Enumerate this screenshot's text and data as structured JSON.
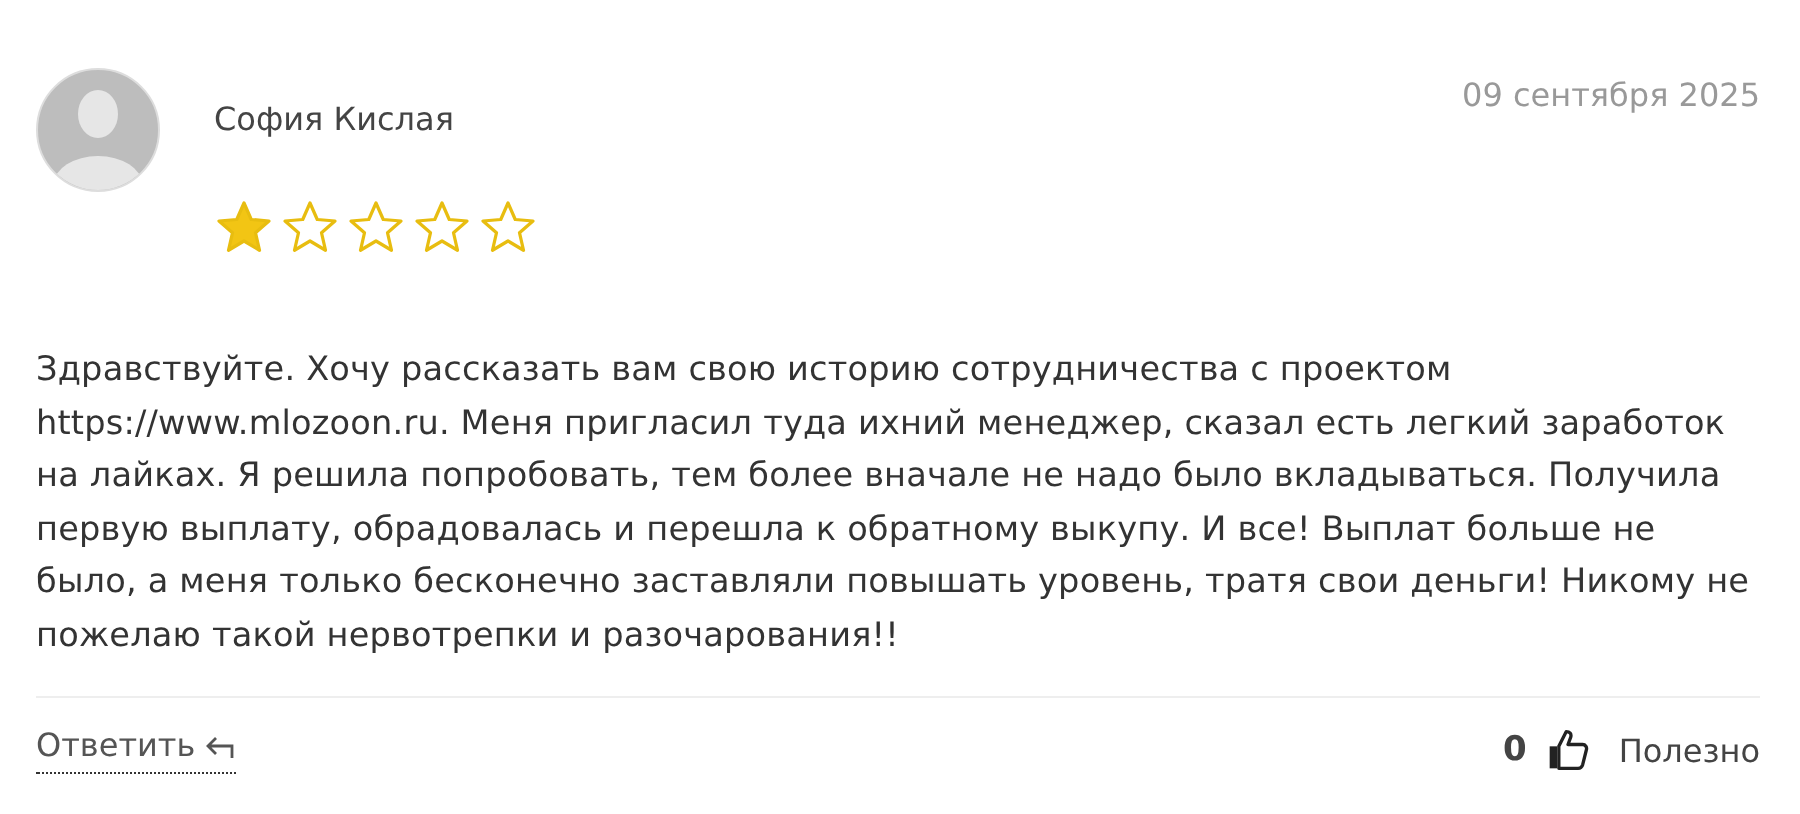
{
  "review": {
    "author": "София Кислая",
    "date": "09 сентября 2025",
    "stars": 1,
    "text": "Здравствуйте. Хочу рассказать вам свою историю сотрудничества с проектом https://www.mlozoon.ru. Меня пригласил туда ихний менеджер, сказал есть легкий заработок на лайках. Я решила попробовать, тем более вначале не надо было вкладываться. Получила первую выплату, обрадовалась и перешла к обратному выкупу. И все! Выплат больше не было, а меня только бесконечно заставляли повышать уровень, тратя свои деньги! Никому не пожелаю такой нервотрепки и разочарования!!",
    "reply_label": "Ответить",
    "likes": "0",
    "helpful_label": "Полезно"
  }
}
